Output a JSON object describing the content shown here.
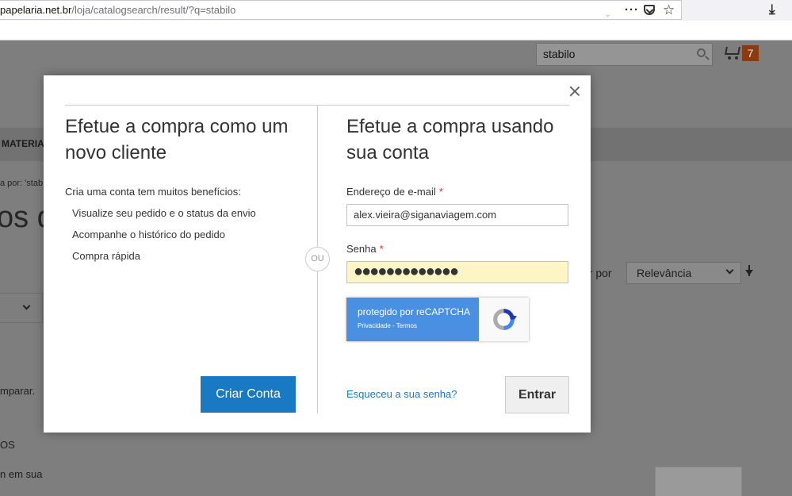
{
  "browser": {
    "url_host": "papelaria.net.br",
    "url_path": "/loja/catalogsearch/result/?q=stabilo"
  },
  "page": {
    "search_value": "stabilo",
    "cart_count": "7",
    "nav_item": "MATERIA",
    "breadcrumb": "a por: 'stab",
    "heading": "os da",
    "sort_label": "ar por",
    "sort_value": "Relevância",
    "text_1": "mparar.",
    "text_2": "OS",
    "text_3": "n em sua"
  },
  "modal": {
    "left": {
      "title": "Efetue a compra como um novo cliente",
      "intro": "Cria uma conta tem muitos benefícios:",
      "benefits": [
        "Visualize seu pedido e o status da envio",
        "Acompanhe o histórico do pedido",
        "Compra rápida"
      ],
      "create_button": "Criar Conta"
    },
    "separator": "OU",
    "right": {
      "title": "Efetue a compra usando sua conta",
      "email_label": "Endereço de e-mail",
      "email_value": "alex.vieira@siganaviagem.com",
      "password_label": "Senha",
      "password_value": "●●●●●●●●●●●●●",
      "required_mark": "*",
      "recaptcha_title": "protegido por reCAPTCHA",
      "recaptcha_links": "Privacidade - Termos",
      "forgot_link": "Esqueceu a sua senha?",
      "login_button": "Entrar"
    }
  },
  "colors": {
    "primary": "#1979c3",
    "required": "#e02b27",
    "recaptcha_blue": "#4a90e2",
    "password_bg": "#fdf6c4"
  }
}
